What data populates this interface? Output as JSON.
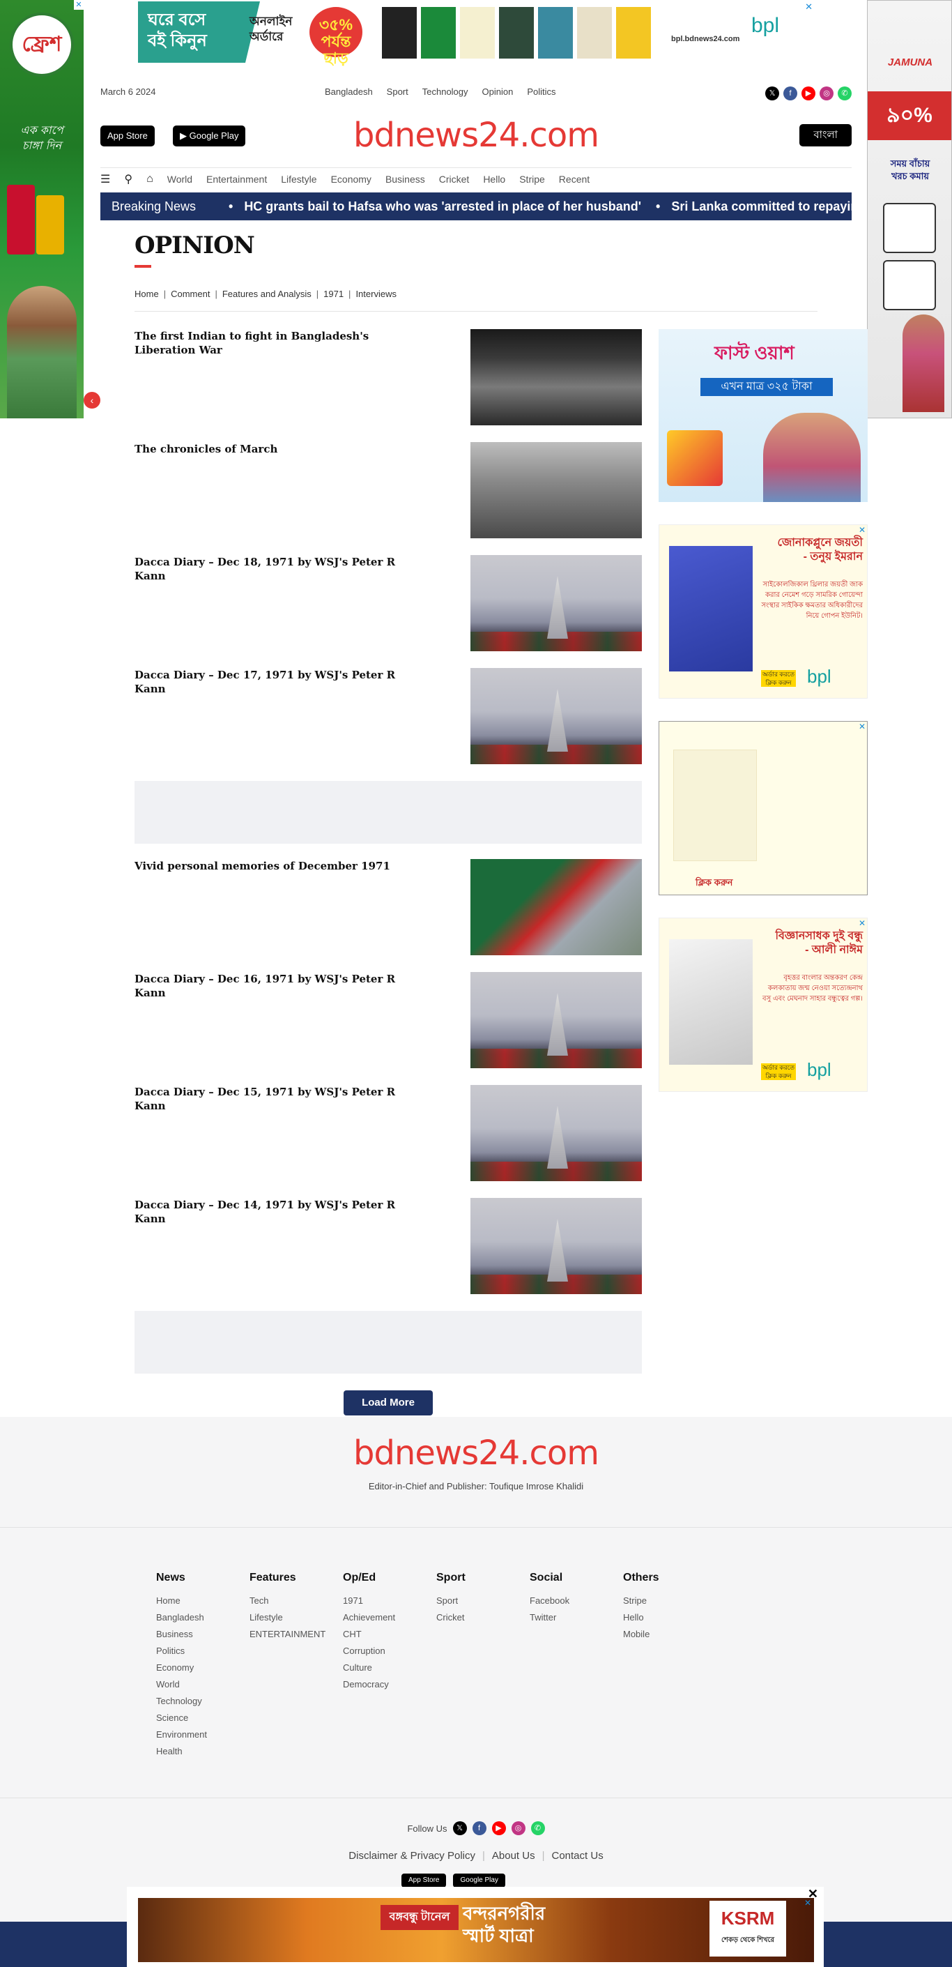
{
  "top_banner": {
    "green_text": "ঘরে বসে\nবই কিনুন",
    "order_text": "অনলাইন\nঅর্ডারে",
    "badge_text": "৩৫%\nপর্যন্ত ছাড়",
    "url": "bpl.bdnews24.com",
    "brand": "bpl"
  },
  "left_side_ad": {
    "logo_text": "ফ্রেশ",
    "tagline": "এক কাপে\nচাঙ্গা দিন"
  },
  "right_side_ad": {
    "brand": "JAMUNA",
    "promo": "৯০%",
    "slogan": "সময় বাঁচায়\nখরচ কমায়"
  },
  "header": {
    "date": "March 6 2024",
    "top_nav": [
      "Bangladesh",
      "Sport",
      "Technology",
      "Opinion",
      "Politics"
    ],
    "app_store_label": "App Store",
    "google_play_label": "Google Play",
    "site_logo": "bdnews24.com",
    "language_button": "বাংলা",
    "main_nav": [
      "World",
      "Entertainment",
      "Lifestyle",
      "Economy",
      "Business",
      "Cricket",
      "Hello",
      "Stripe",
      "Recent"
    ]
  },
  "breaking": {
    "label": "Breaking News",
    "items": [
      "HC grants bail to Hafsa who was 'arrested in place of her husband'",
      "Sri Lanka committed to repaying"
    ]
  },
  "section": {
    "title": "OPINION",
    "breadcrumbs": [
      "Home",
      "Comment",
      "Features and Analysis",
      "1971",
      "Interviews"
    ]
  },
  "articles": [
    {
      "title": "The first Indian to fight in Bangladesh's Liberation War",
      "image": "bw-group"
    },
    {
      "title": "The chronicles of March",
      "image": "bw-flag"
    },
    {
      "title": "Dacca Diary – Dec 18, 1971 by WSJ's Peter R Kann",
      "image": "monument"
    },
    {
      "title": "Dacca Diary – Dec 17, 1971 by WSJ's Peter R Kann",
      "image": "monument"
    },
    {
      "title": "Vivid personal memories of December 1971",
      "image": "flag"
    },
    {
      "title": "Dacca Diary – Dec 16, 1971 by WSJ's Peter R Kann",
      "image": "monument"
    },
    {
      "title": "Dacca Diary – Dec 15, 1971 by WSJ's Peter R Kann",
      "image": "monument"
    },
    {
      "title": "Dacca Diary – Dec 14, 1971 by WSJ's Peter R Kann",
      "image": "monument"
    }
  ],
  "right_ads": {
    "ad1_headline": "ফাস্ট ওয়াশ",
    "ad1_bar": "এখন মাত্র ৩২৫ টাকা",
    "ad2_title": "জোনাকপ্লুনে জয়তী\n- তনুয় ইমরান",
    "ad2_lines": "সাইকোলজিকাল থ্রিলার\nজয়তী জাক করার নেমেশ গড়ে সামরিক গোয়েন্দা সংস্থার সাইকিক ক্ষমতার অধিকারীদের নিয়ে গোপন ইউনিট।",
    "ad_cta": "অর্ডার করতে ক্লিক করুন",
    "ad3_click": "ক্লিক করুন",
    "ad4_title": "বিজ্ঞানসাধক দুই বন্ধু\n- আলী নাঈম",
    "ad4_lines": "বৃহত্তর বাংলার অন্তকরণ কেন্দ্র\nকলকাতায় জন্ম নেওয়া সত্যেন্দ্রনাথ বসু এবং মেঘনাদ সাহার বন্ধুত্বের গল্প।",
    "bpl": "bpl"
  },
  "load_more": "Load More",
  "footer": {
    "logo": "bdnews24.com",
    "editor": "Editor-in-Chief and Publisher: Toufique Imrose Khalidi",
    "columns": [
      {
        "heading": "News",
        "links": [
          "Home",
          "Bangladesh",
          "Business",
          "Politics",
          "Economy",
          "World",
          "Technology",
          "Science",
          "Environment",
          "Health"
        ]
      },
      {
        "heading": "Features",
        "links": [
          "Tech",
          "Lifestyle",
          "ENTERTAINMENT"
        ]
      },
      {
        "heading": "Op/Ed",
        "links": [
          "1971",
          "Achievement",
          "CHT",
          "Corruption",
          "Culture",
          "Democracy"
        ]
      },
      {
        "heading": "Sport",
        "links": [
          "Sport",
          "Cricket"
        ]
      },
      {
        "heading": "Social",
        "links": [
          "Facebook",
          "Twitter"
        ]
      },
      {
        "heading": "Others",
        "links": [
          "Stripe",
          "Hello",
          "Mobile"
        ]
      }
    ],
    "follow_us": "Follow Us",
    "policy_links": [
      "Disclaimer & Privacy Policy",
      "About Us",
      "Contact Us"
    ],
    "app_store": "App Store",
    "google_play": "Google Play"
  },
  "bottom_ad": {
    "red_label": "বঙ্গবন্ধু টানেল",
    "headline": "বন্দরনগরীর\nস্মার্ট যাত্রা",
    "brand": "KSRM",
    "brand_sub": "শেকড় থেকে শিখরে"
  },
  "colors": {
    "brand_red": "#e53935",
    "navy": "#1e3264",
    "x": "#000000",
    "facebook": "#3b5998",
    "youtube": "#ff0000",
    "instagram": "#c13584",
    "whatsapp": "#25d366"
  }
}
